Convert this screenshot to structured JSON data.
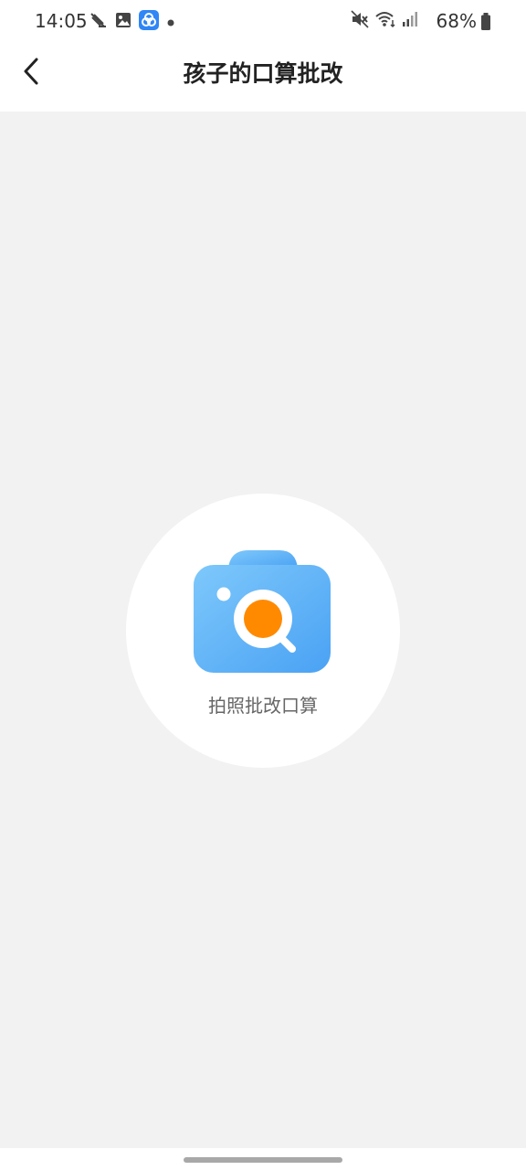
{
  "status_bar": {
    "time": "14:05",
    "battery": "68%",
    "left_icons": [
      "notification-app-icon",
      "gallery-icon",
      "app-badge-icon",
      "dot-icon"
    ],
    "right_icons": [
      "mute-icon",
      "wifi-icon",
      "signal-icon",
      "battery-icon"
    ]
  },
  "nav": {
    "title": "孩子的口算批改",
    "back_icon": "chevron-left-icon"
  },
  "main": {
    "capture_label": "拍照批改口算",
    "capture_icon": "camera-search-icon"
  },
  "colors": {
    "background": "#f2f2f2",
    "surface": "#ffffff",
    "camera_blue": "#5aaef8",
    "camera_orange": "#ff8a00",
    "title_text": "#222222",
    "label_text": "#666666"
  }
}
